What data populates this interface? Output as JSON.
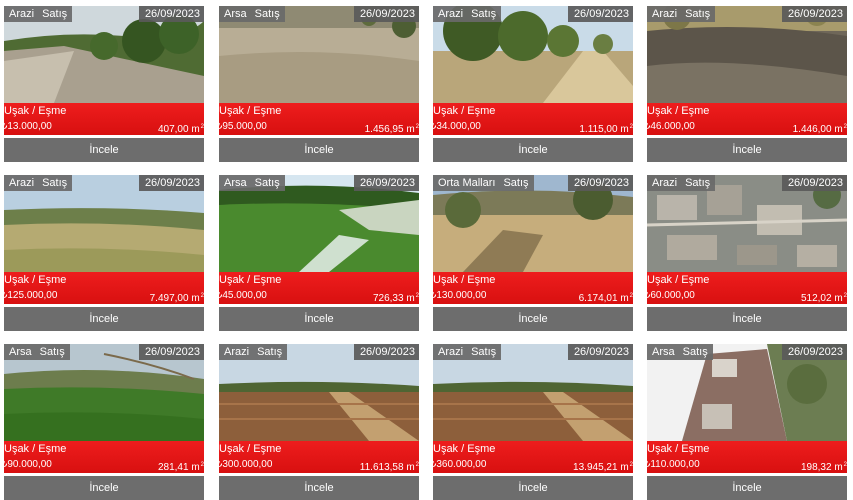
{
  "listings": [
    {
      "type": "Arazi",
      "deal": "Satış",
      "date": "26/09/2023",
      "location": "Uşak / Eşme",
      "price": "₺13.000,00",
      "area": "407,00 m",
      "unit_sup": "2",
      "button": "İncele",
      "photo": "dirt-road"
    },
    {
      "type": "Arsa",
      "deal": "Satış",
      "date": "26/09/2023",
      "location": "Uşak / Eşme",
      "price": "₺95.000,00",
      "area": "1.456,95 m",
      "unit_sup": "2",
      "button": "İncele",
      "photo": "dry-field"
    },
    {
      "type": "Arazi",
      "deal": "Satış",
      "date": "26/09/2023",
      "location": "Uşak / Eşme",
      "price": "₺34.000,00",
      "area": "1.115,00 m",
      "unit_sup": "2",
      "button": "İncele",
      "photo": "trees-path"
    },
    {
      "type": "Arazi",
      "deal": "Satış",
      "date": "26/09/2023",
      "location": "Uşak / Eşme",
      "price": "₺46.000,00",
      "area": "1.446,00 m",
      "unit_sup": "2",
      "button": "İncele",
      "photo": "burnt-ground"
    },
    {
      "type": "Arazi",
      "deal": "Satış",
      "date": "26/09/2023",
      "location": "Uşak / Eşme",
      "price": "₺125.000,00",
      "area": "7.497,00 m",
      "unit_sup": "2",
      "button": "İncele",
      "photo": "meadow"
    },
    {
      "type": "Arsa",
      "deal": "Satış",
      "date": "26/09/2023",
      "location": "Uşak / Eşme",
      "price": "₺45.000,00",
      "area": "726,33 m",
      "unit_sup": "2",
      "button": "İncele",
      "photo": "green-valley"
    },
    {
      "type": "Orta Malları",
      "deal": "Satış",
      "date": "26/09/2023",
      "location": "Uşak / Eşme",
      "price": "₺130.000,00",
      "area": "6.174,01 m",
      "unit_sup": "2",
      "button": "İncele",
      "photo": "dry-path"
    },
    {
      "type": "Arazi",
      "deal": "Satış",
      "date": "26/09/2023",
      "location": "Uşak / Eşme",
      "price": "₺60.000,00",
      "area": "512,02 m",
      "unit_sup": "2",
      "button": "İncele",
      "photo": "aerial-town"
    },
    {
      "type": "Arsa",
      "deal": "Satış",
      "date": "26/09/2023",
      "location": "Uşak / Eşme",
      "price": "₺90.000,00",
      "area": "281,41 m",
      "unit_sup": "2",
      "button": "İncele",
      "photo": "grass-field"
    },
    {
      "type": "Arazi",
      "deal": "Satış",
      "date": "26/09/2023",
      "location": "Uşak / Eşme",
      "price": "₺300.000,00",
      "area": "11.613,58 m",
      "unit_sup": "2",
      "button": "İncele",
      "photo": "plowed-field"
    },
    {
      "type": "Arazi",
      "deal": "Satış",
      "date": "26/09/2023",
      "location": "Uşak / Eşme",
      "price": "₺360.000,00",
      "area": "13.945,21 m",
      "unit_sup": "2",
      "button": "İncele",
      "photo": "plowed-field"
    },
    {
      "type": "Arsa",
      "deal": "Satış",
      "date": "26/09/2023",
      "location": "Uşak / Eşme",
      "price": "₺110.000,00",
      "area": "198,32 m",
      "unit_sup": "2",
      "button": "İncele",
      "photo": "old-house"
    }
  ],
  "colors": {
    "accent_red": "#e41b1b",
    "button_gray": "#6d6d6d",
    "badge_gray": "#696969"
  }
}
